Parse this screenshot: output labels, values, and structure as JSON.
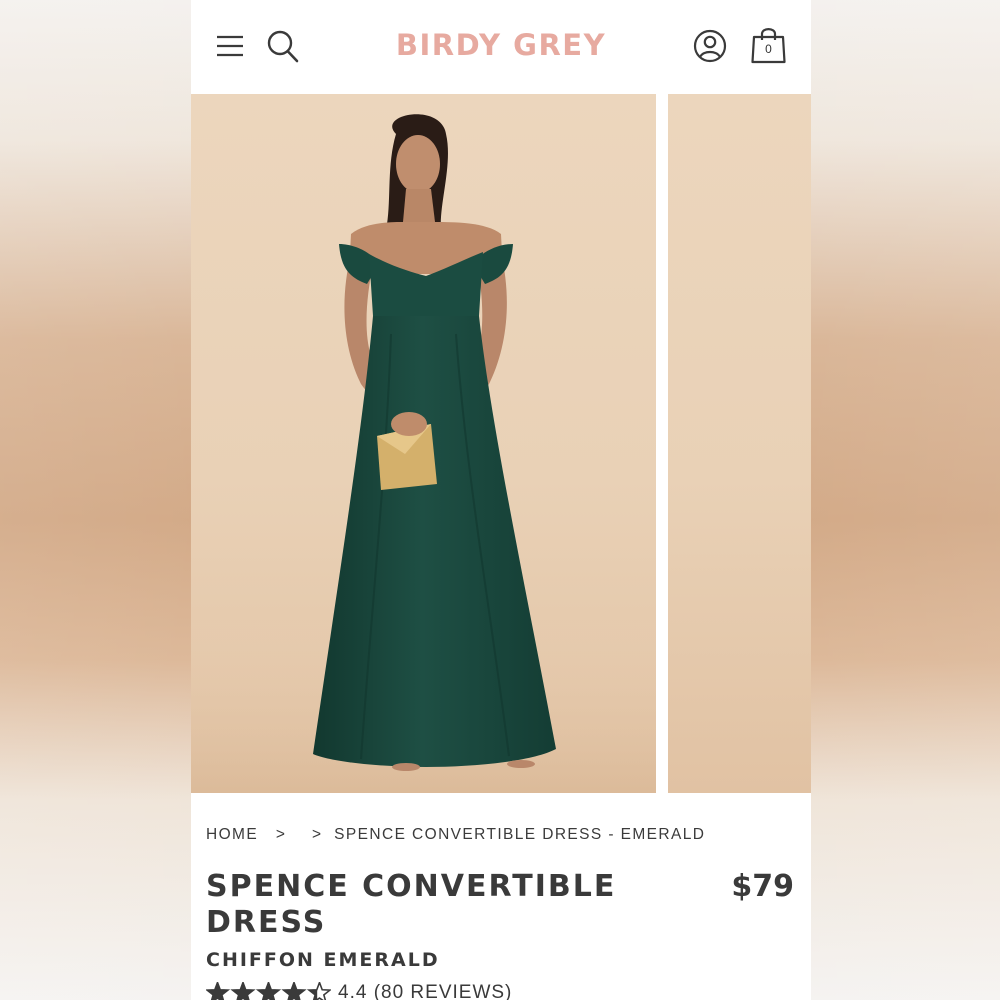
{
  "brand": {
    "name": "BIRDY GREY",
    "color": "#e7aaa0"
  },
  "header": {
    "icons": [
      "menu-icon",
      "search-icon",
      "account-icon",
      "shopping-bag-icon"
    ],
    "cart_count": "0"
  },
  "breadcrumb": {
    "home": "HOME",
    "separator": ">",
    "current": "SPENCE CONVERTIBLE DRESS - EMERALD"
  },
  "product": {
    "title": "SPENCE CONVERTIBLE DRESS",
    "price": "$79",
    "subtitle": "CHIFFON EMERALD",
    "rating": 4.4,
    "rating_max": 5,
    "rating_text": "4.4 (80 REVIEWS)"
  },
  "colors": {
    "photo_background": "#ecd6bd",
    "dress": "#1c4a40",
    "text": "#3a3a3a"
  }
}
